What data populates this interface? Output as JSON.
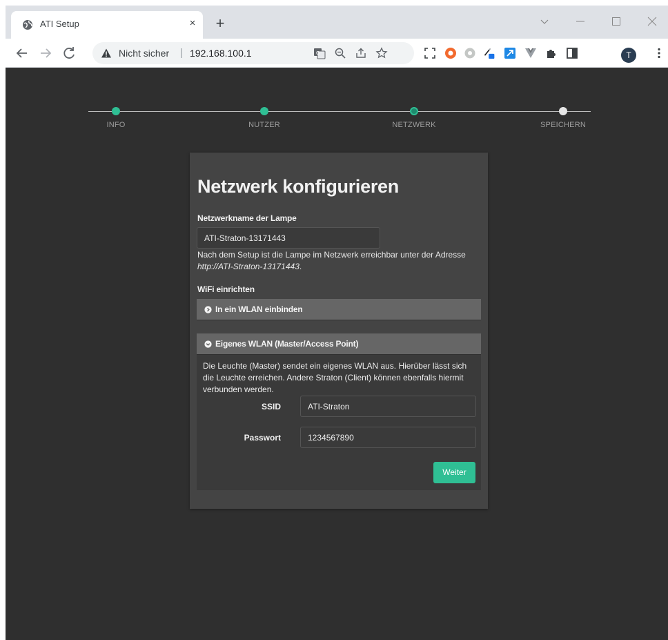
{
  "browser": {
    "tab_title": "ATI Setup",
    "tab_close": "×",
    "new_tab": "+",
    "security_label": "Nicht sicher",
    "url_separator": "|",
    "url": "192.168.100.1",
    "profile_initial": "T"
  },
  "stepper": {
    "steps": [
      {
        "label": "INFO",
        "state": "done"
      },
      {
        "label": "NUTZER",
        "state": "done"
      },
      {
        "label": "NETZWERK",
        "state": "active"
      },
      {
        "label": "SPEICHERN",
        "state": "pending"
      }
    ],
    "colors": {
      "done": "#2fbf94",
      "active": "#1f8a6e",
      "pending": "#e6e6e6"
    }
  },
  "card": {
    "title": "Netzwerk konfigurieren",
    "network_name_label": "Netzwerkname der Lampe",
    "network_name_value": "ATI-Straton-13171443",
    "help_prefix": "Nach dem Setup ist die Lampe im Netzwerk erreichbar unter der Adresse ",
    "help_address": "http://ATI-Straton-13171443",
    "help_suffix": ".",
    "wifi_label": "WiFi einrichten",
    "accordion_join": {
      "title": "In ein WLAN einbinden",
      "expanded": false
    },
    "accordion_master": {
      "title": "Eigenes WLAN (Master/Access Point)",
      "expanded": true,
      "description": "Die Leuchte (Master) sendet ein eigenes WLAN aus. Hierüber lässt sich die Leuchte erreichen. Andere Straton (Client) können ebenfalls hiermit verbunden werden.",
      "ssid_label": "SSID",
      "ssid_value": "ATI-Straton",
      "password_label": "Passwort",
      "password_value": "1234567890",
      "next_button": "Weiter"
    }
  },
  "colors": {
    "accent": "#2fbf94",
    "page_bg": "#2f2f2f",
    "card_bg": "#444444"
  }
}
